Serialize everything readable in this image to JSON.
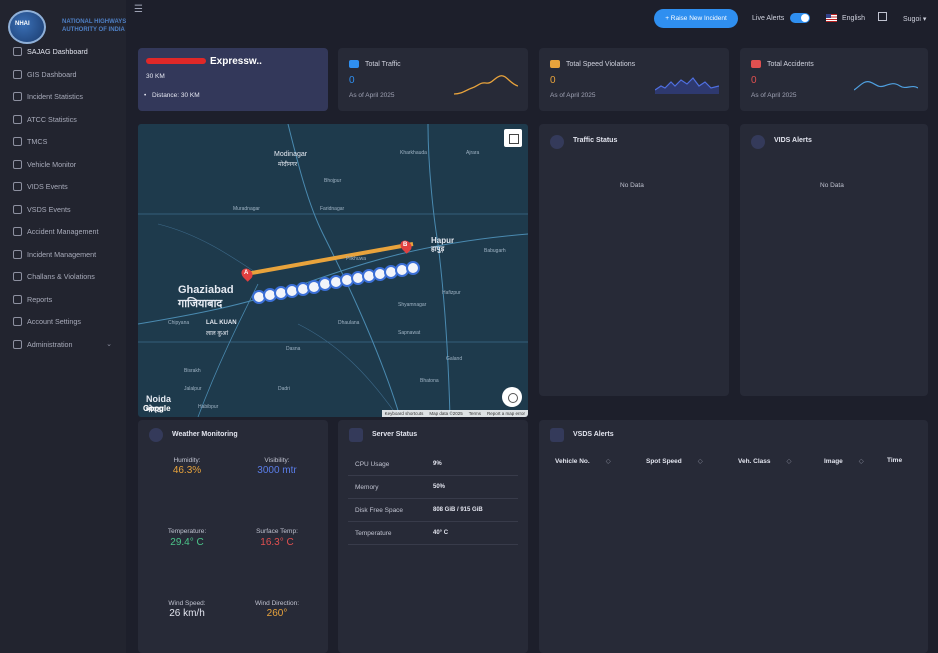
{
  "brand": {
    "emblem": "NHAI",
    "line1": "NATIONAL HIGHWAYS",
    "line2": "AUTHORITY OF INDIA"
  },
  "sidebar": {
    "items": [
      {
        "label": "SAJAG Dashboard"
      },
      {
        "label": "GIS Dashboard"
      },
      {
        "label": "Incident Statistics"
      },
      {
        "label": "ATCC Statistics"
      },
      {
        "label": "TMCS"
      },
      {
        "label": "Vehicle Monitor"
      },
      {
        "label": "VIDS Events"
      },
      {
        "label": "VSDS Events"
      },
      {
        "label": "Accident Management"
      },
      {
        "label": "Incident Management"
      },
      {
        "label": "Challans & Violations"
      },
      {
        "label": "Reports"
      },
      {
        "label": "Account Settings"
      },
      {
        "label": "Administration"
      }
    ]
  },
  "topbar": {
    "raise_btn": "+ Raise New Incident",
    "live_alerts": "Live Alerts",
    "language": "English",
    "user": "Sugoi"
  },
  "road": {
    "name": "Expressw..",
    "km": "30 KM",
    "distance": "Distance: 30 KM"
  },
  "stats": [
    {
      "title": "Total Traffic",
      "value": "0",
      "date": "As of April 2025",
      "color": "#2f8ff0",
      "spark_color": "#e8a33c"
    },
    {
      "title": "Total Speed Violations",
      "value": "0",
      "date": "As of April 2025",
      "color": "#e8a33c",
      "spark_color": "#4f6fe0"
    },
    {
      "title": "Total Accidents",
      "value": "0",
      "date": "As of April 2025",
      "color": "#e05050",
      "spark_color": "#4fa0e0"
    }
  ],
  "map": {
    "cities": {
      "ghaziabad": "Ghaziabad",
      "ghaziabad_hi": "गाजियाबाद",
      "hapur": "Hapur",
      "hapur_hi": "हापुड़",
      "noida": "Noida",
      "noida_hi": "नोएडा",
      "modinagar": "Modinagar",
      "modinagar_hi": "मोदीनगर",
      "lalkuan": "LAL KUAN",
      "lalkuan_hi": "लाल कुआं"
    },
    "small": [
      "Kharkhauda",
      "Ajrara",
      "Bhojpur",
      "Muradnagar",
      "Faridnagar",
      "Pilkhuwa",
      "Dhaulana",
      "Sapnawat",
      "Galand",
      "Dasna",
      "Dadri",
      "Bhatona",
      "Chipyana",
      "Bisrakh",
      "Jalalpur",
      "Habibpur",
      "Shyamnagar",
      "Babugarh",
      "Hafizpur"
    ],
    "google": "Google",
    "footer": [
      "Keyboard shortcuts",
      "Map data ©2025",
      "Terms",
      "Report a map error"
    ],
    "marker_a": "A",
    "marker_b": "B"
  },
  "traffic_status": {
    "title": "Traffic Status",
    "nodata": "No Data"
  },
  "vids_alerts": {
    "title": "VIDS Alerts",
    "nodata": "No Data"
  },
  "weather": {
    "title": "Weather Monitoring",
    "humidity_label": "Humidity:",
    "humidity": "46.3%",
    "visibility_label": "Visibility:",
    "visibility": "3000 mtr",
    "temp_label": "Temperature:",
    "temp": "29.4° C",
    "surface_label": "Surface Temp:",
    "surface": "16.3° C",
    "wind_speed_label": "Wind Speed:",
    "wind_speed": "26 km/h",
    "wind_dir_label": "Wind Direction:",
    "wind_dir": "260°"
  },
  "server": {
    "title": "Server Status",
    "rows": [
      {
        "k": "CPU Usage",
        "v": "9%"
      },
      {
        "k": "Memory",
        "v": "50%"
      },
      {
        "k": "Disk Free Space",
        "v": "808 GiB / 915 GiB"
      },
      {
        "k": "Temperature",
        "v": "40° C"
      }
    ]
  },
  "vsds": {
    "title": "VSDS Alerts",
    "columns": [
      "Vehicle No.",
      "Spot Speed",
      "Veh. Class",
      "Image",
      "Time"
    ]
  },
  "colors": {
    "accent": "#2f8ff0",
    "orange": "#e8a33c",
    "red": "#e05050",
    "green": "#4cc58a"
  }
}
